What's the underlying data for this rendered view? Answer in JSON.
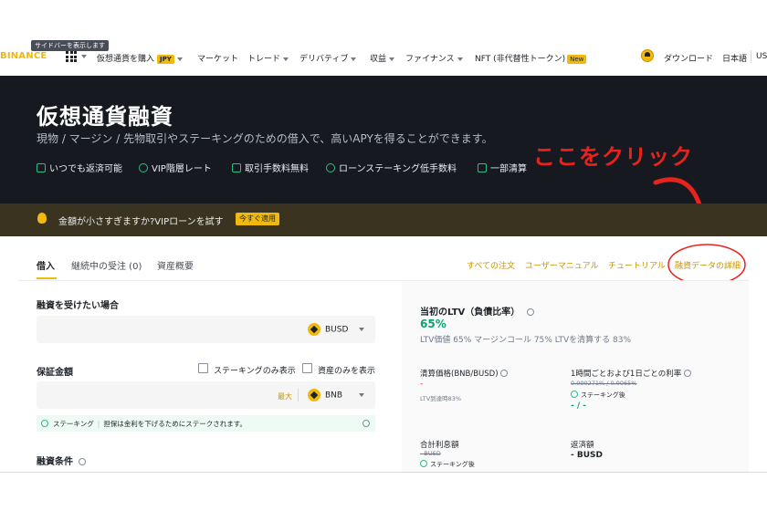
{
  "topnav": {
    "tooltip": "サイドバーを表示します",
    "logo": "BINANCE",
    "items": [
      {
        "label": "仮想通貨を購入",
        "badge": "JPY"
      },
      {
        "label": "マーケット"
      },
      {
        "label": "トレード"
      },
      {
        "label": "デリバティブ"
      },
      {
        "label": "収益"
      },
      {
        "label": "ファイナンス"
      },
      {
        "label": "NFT (非代替性トークン)",
        "badge": "New"
      }
    ],
    "download": "ダウンロード",
    "language": "日本語",
    "currency": "USD"
  },
  "hero": {
    "title": "仮想通貨融資",
    "subtitle": "現物 / マージン / 先物取引やステーキングのための借入で、高いAPYを得ることができます。",
    "features": [
      "いつでも返済可能",
      "VIP階層レート",
      "取引手数料無料",
      "ローンステーキング低手数料",
      "一部清算"
    ]
  },
  "promo": {
    "text": "金額が小さすぎますか?VIPローンを試す",
    "button": "今すぐ適用"
  },
  "annotation": {
    "text": "ここをクリック",
    "color": "#e8231d"
  },
  "tabs": [
    {
      "label": "借入",
      "active": true
    },
    {
      "label": "継続中の受注 (0)",
      "active": false
    },
    {
      "label": "資産概要",
      "active": false
    }
  ],
  "links": {
    "all_orders": "すべての注文",
    "manual": "ユーザーマニュアル",
    "tutorial": "チュートリアル",
    "details": "融資データの詳細"
  },
  "form": {
    "borrow_label": "融資を受けたい場合",
    "borrow_coin": "BUSD",
    "collateral_label": "保証金額",
    "staking_only": "ステーキングのみ表示",
    "assets_only": "資産のみを表示",
    "max": "最大",
    "collateral_coin": "BNB",
    "staking_tag": "ステーキング",
    "staking_note": "担保は金利を下げるためにステークされます。",
    "terms_label": "融資条件"
  },
  "panel": {
    "ltv_title": "当初のLTV（負債比率）",
    "ltv_value": "65%",
    "ltv_sub": "LTV価値 65%  マージンコール 75%  LTVを清算する 83%",
    "liq_price_label": "清算価格(BNB/BUSD)",
    "liq_price_value": "-",
    "liq_note": "LTV到達時83%",
    "rate_label": "1時間ごとおよび1日ごとの利率",
    "rate_strike": "0.000271% / 0.0065%",
    "after_staking": "ステーキング後",
    "rate_after": "- / -",
    "interest_label": "合計利息額",
    "interest_strike": "- BUSD",
    "repay_label": "返済額",
    "repay_value": "- BUSD"
  },
  "colors": {
    "accent": "#f0b90b",
    "hero_bg": "#16191f",
    "positive": "#03a66d",
    "link": "#c99400"
  }
}
